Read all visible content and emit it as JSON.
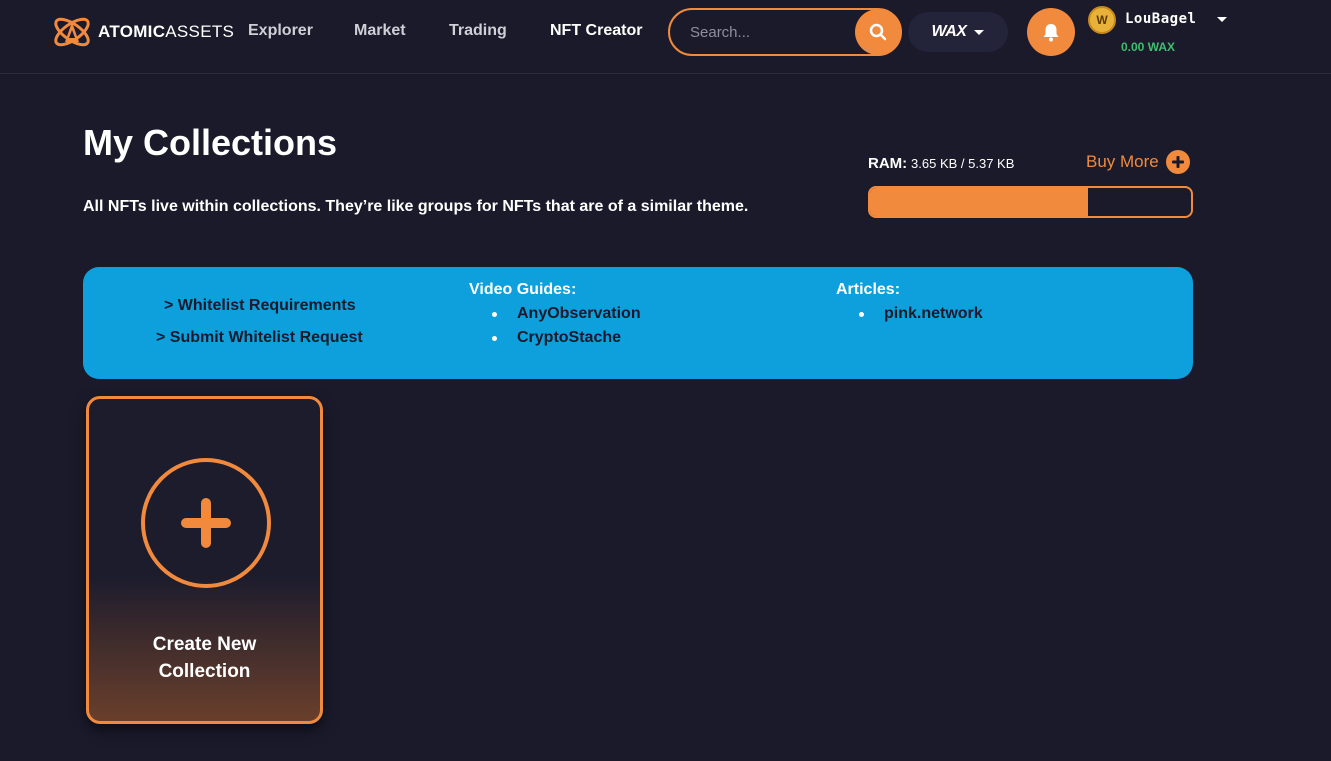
{
  "brand": {
    "name_bold": "ATOMIC",
    "name_light": "ASSETS"
  },
  "nav": [
    {
      "label": "Explorer"
    },
    {
      "label": "Market"
    },
    {
      "label": "Trading"
    },
    {
      "label": "NFT Creator"
    }
  ],
  "search": {
    "placeholder": "Search..."
  },
  "chain": {
    "label": "WAX"
  },
  "user": {
    "avatar_letter": "W",
    "name": "LouBagel",
    "balance": "0.00 WAX"
  },
  "page": {
    "title": "My Collections",
    "subtitle": "All NFTs live within collections. They’re like groups for NFTs that are of a similar theme."
  },
  "ram": {
    "label": "RAM:",
    "value": "3.65 KB / 5.37 KB",
    "percent": 68,
    "percent_label": "68%",
    "buy_more": "Buy More"
  },
  "banner": {
    "whitelist_requirements": "> Whitelist Requirements",
    "submit_whitelist": "> Submit Whitelist Request",
    "video_heading": "Video Guides:",
    "videos": [
      "AnyObservation",
      "CryptoStache"
    ],
    "articles_heading": "Articles:",
    "articles": [
      "pink.network"
    ]
  },
  "create_card": {
    "line1": "Create New",
    "line2": "Collection"
  },
  "colors": {
    "accent": "#f18a3c",
    "banner": "#0da0dc",
    "background": "#1a1a2b",
    "balance": "#3fbf6e"
  }
}
